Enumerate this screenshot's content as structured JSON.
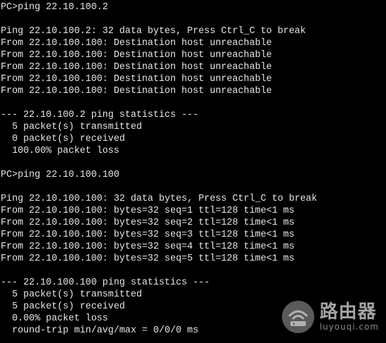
{
  "terminal": {
    "lines": [
      "PC>ping 22.10.100.2",
      "",
      "Ping 22.10.100.2: 32 data bytes, Press Ctrl_C to break",
      "From 22.10.100.100: Destination host unreachable",
      "From 22.10.100.100: Destination host unreachable",
      "From 22.10.100.100: Destination host unreachable",
      "From 22.10.100.100: Destination host unreachable",
      "From 22.10.100.100: Destination host unreachable",
      "",
      "--- 22.10.100.2 ping statistics ---",
      "  5 packet(s) transmitted",
      "  0 packet(s) received",
      "  100.00% packet loss",
      "",
      "PC>ping 22.10.100.100",
      "",
      "Ping 22.10.100.100: 32 data bytes, Press Ctrl_C to break",
      "From 22.10.100.100: bytes=32 seq=1 ttl=128 time<1 ms",
      "From 22.10.100.100: bytes=32 seq=2 ttl=128 time<1 ms",
      "From 22.10.100.100: bytes=32 seq=3 ttl=128 time<1 ms",
      "From 22.10.100.100: bytes=32 seq=4 ttl=128 time<1 ms",
      "From 22.10.100.100: bytes=32 seq=5 ttl=128 time<1 ms",
      "",
      "--- 22.10.100.100 ping statistics ---",
      "  5 packet(s) transmitted",
      "  5 packet(s) received",
      "  0.00% packet loss",
      "  round-trip min/avg/max = 0/0/0 ms"
    ]
  },
  "watermark": {
    "title": "路由器",
    "url": "luyouqi.com",
    "icon": "router-logo-icon"
  },
  "colors": {
    "background": "#000000",
    "text": "#e6e6e6"
  }
}
